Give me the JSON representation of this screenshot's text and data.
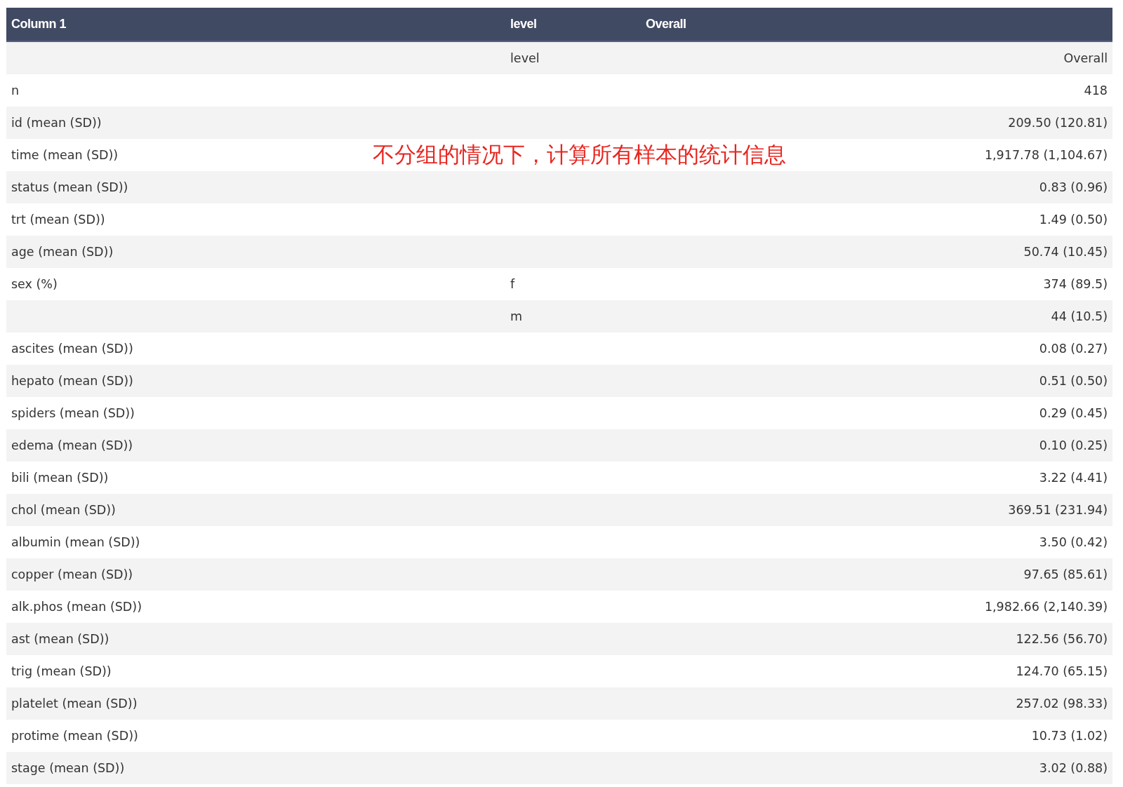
{
  "table": {
    "columns": [
      "Column 1",
      "level",
      "Overall"
    ],
    "rows": [
      {
        "cells": [
          "",
          "level",
          "Overall"
        ]
      },
      {
        "cells": [
          "n",
          "",
          "418"
        ]
      },
      {
        "cells": [
          "id (mean (SD))",
          "",
          "209.50 (120.81)"
        ]
      },
      {
        "cells": [
          "time (mean (SD))",
          "",
          "1,917.78 (1,104.67)"
        ]
      },
      {
        "cells": [
          "status (mean (SD))",
          "",
          "0.83 (0.96)"
        ]
      },
      {
        "cells": [
          "trt (mean (SD))",
          "",
          "1.49 (0.50)"
        ]
      },
      {
        "cells": [
          "age (mean (SD))",
          "",
          "50.74 (10.45)"
        ]
      },
      {
        "cells": [
          "sex (%)",
          "f",
          "374 (89.5)"
        ]
      },
      {
        "cells": [
          "",
          "m",
          "44 (10.5)"
        ]
      },
      {
        "cells": [
          "ascites (mean (SD))",
          "",
          "0.08 (0.27)"
        ]
      },
      {
        "cells": [
          "hepato (mean (SD))",
          "",
          "0.51 (0.50)"
        ]
      },
      {
        "cells": [
          "spiders (mean (SD))",
          "",
          "0.29 (0.45)"
        ]
      },
      {
        "cells": [
          "edema (mean (SD))",
          "",
          "0.10 (0.25)"
        ]
      },
      {
        "cells": [
          "bili (mean (SD))",
          "",
          "3.22 (4.41)"
        ]
      },
      {
        "cells": [
          "chol (mean (SD))",
          "",
          "369.51 (231.94)"
        ]
      },
      {
        "cells": [
          "albumin (mean (SD))",
          "",
          "3.50 (0.42)"
        ]
      },
      {
        "cells": [
          "copper (mean (SD))",
          "",
          "97.65 (85.61)"
        ]
      },
      {
        "cells": [
          "alk.phos (mean (SD))",
          "",
          "1,982.66 (2,140.39)"
        ]
      },
      {
        "cells": [
          "ast (mean (SD))",
          "",
          "122.56 (56.70)"
        ]
      },
      {
        "cells": [
          "trig (mean (SD))",
          "",
          "124.70 (65.15)"
        ]
      },
      {
        "cells": [
          "platelet (mean (SD))",
          "",
          "257.02 (98.33)"
        ]
      },
      {
        "cells": [
          "protime (mean (SD))",
          "",
          "10.73 (1.02)"
        ]
      },
      {
        "cells": [
          "stage (mean (SD))",
          "",
          "3.02 (0.88)"
        ]
      }
    ]
  },
  "annotation": {
    "text": "不分组的情况下，计算所有样本的统计信息"
  }
}
